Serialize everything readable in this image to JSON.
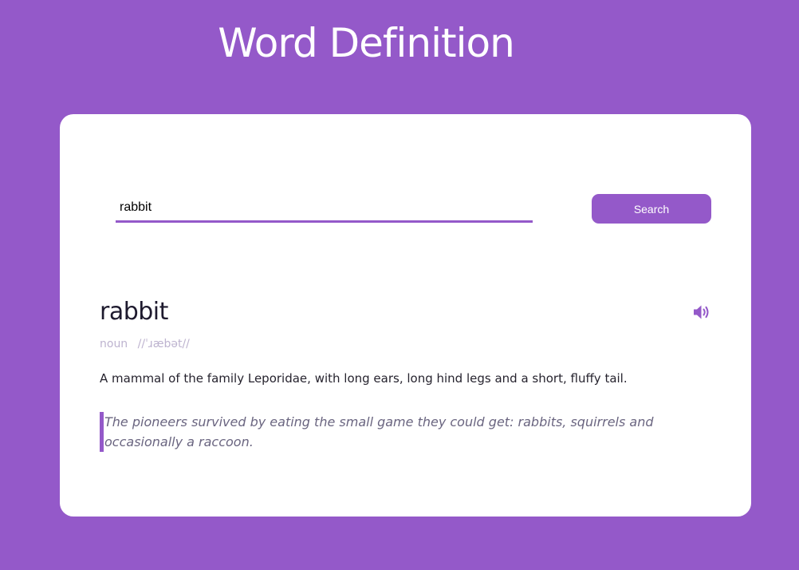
{
  "header": {
    "title": "Word Definition"
  },
  "search": {
    "value": "rabbit",
    "button_label": "Search"
  },
  "result": {
    "word": "rabbit",
    "part_of_speech": "noun",
    "phonetic": "//ˈɹæbət//",
    "definition": "A mammal of the family Leporidae, with long ears, long hind legs and a short, fluffy tail.",
    "example": "The pioneers survived by eating the small game they could get: rabbits, squirrels and occasionally a raccoon.",
    "audio_icon": "speaker-volume-icon"
  },
  "colors": {
    "accent": "#9459c9",
    "card": "#ffffff",
    "word_text": "#1e1a2e",
    "meta_text": "#bdb3cf",
    "example_text": "#6a6580"
  }
}
